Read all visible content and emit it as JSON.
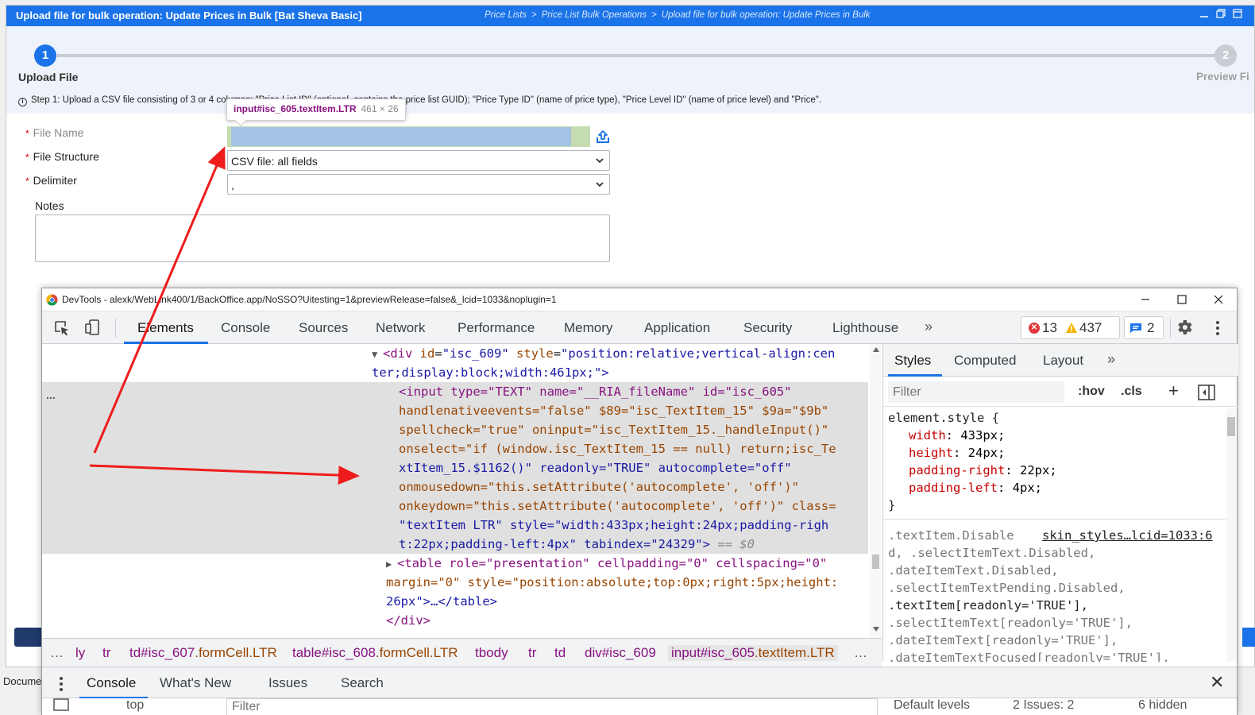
{
  "app": {
    "title": "Upload file for bulk operation: Update Prices in Bulk [Bat Sheva Basic]",
    "breadcrumb": [
      "Price Lists",
      "Price List Bulk Operations",
      "Upload file for bulk operation: Update Prices in Bulk"
    ],
    "breadcrumb_sep": ">",
    "window_buttons": [
      "minimize-icon",
      "restore-icon",
      "close-icon"
    ],
    "accent_color": "#1a73e8"
  },
  "wizard": {
    "steps": [
      {
        "number": "1",
        "label": "Upload File",
        "active": true
      },
      {
        "number": "2",
        "label": "Preview Fi",
        "active": false
      }
    ],
    "info_text": "Step 1: Upload a CSV file consisting of 3 or 4 columns: \"Price List ID\" (optional, contains the price list GUID); \"Price Type ID\" (name of price type), \"Price Level ID\" (name of price level) and \"Price\"."
  },
  "form": {
    "required_mark": "*",
    "file_name_label": "File Name",
    "file_structure_label": "File Structure",
    "file_structure_value": "CSV file: all fields",
    "delimiter_label": "Delimiter",
    "delimiter_value": ",",
    "notes_label": "Notes",
    "notes_value": ""
  },
  "inspect_tooltip": {
    "tag": "input#isc_605.textItem.LTR",
    "size": "461 × 26"
  },
  "taskbar_label": "Docume",
  "devtools": {
    "title": "DevTools - alexk/WebLink400/1/BackOffice.app/NoSSO?Uitesting=1&previewRelease=false&_lcid=1033&noplugin=1",
    "tabs": [
      "Elements",
      "Console",
      "Sources",
      "Network",
      "Performance",
      "Memory",
      "Application",
      "Security",
      "Lighthouse"
    ],
    "more_tabs": "»",
    "error_count": "13",
    "warning_count": "437",
    "issues_count": "2",
    "elements_code": {
      "line1_tag": "<div",
      "line1_attrs": [
        {
          "name": "id",
          "value": "\"isc_609\""
        },
        {
          "name": "style",
          "value": "\"position:relative;vertical-align:cen"
        }
      ],
      "line2": "ter;display:block;width:461px;\">",
      "input_lines": [
        "<input type=\"TEXT\" name=\"__RIA_fileName\" id=\"isc_605\"",
        "handlenativeevents=\"false\" $89=\"isc_TextItem_15\" $9a=\"$9b\"",
        "spellcheck=\"true\" oninput=\"isc_TextItem_15._handleInput()\"",
        "onselect=\"if (window.isc_TextItem_15 == null) return;isc_Te",
        "xtItem_15.$1162()\" readonly=\"TRUE\" autocomplete=\"off\"",
        "onmousedown=\"this.setAttribute('autocomplete', 'off')\"",
        "onkeydown=\"this.setAttribute('autocomplete', 'off')\" class=",
        "\"textItem LTR\" style=\"width:433px;height:24px;padding-righ",
        "t:22px;padding-left:4px\" tabindex=\"24329\">"
      ],
      "selected_marker": "== $0",
      "table_lines": [
        "<table role=\"presentation\" cellpadding=\"0\" cellspacing=\"0\"",
        "margin=\"0\" style=\"position:absolute;top:0px;right:5px;height:",
        "26px\">…</table>"
      ],
      "close_div": "</div>",
      "ellipsis": "..."
    },
    "styles_tabs": [
      "Styles",
      "Computed",
      "Layout"
    ],
    "styles_more": "»",
    "filter_placeholder": "Filter",
    "hov": ":hov",
    "cls": ".cls",
    "plus": "+",
    "element_style": {
      "selector": "element.style {",
      "props": [
        {
          "name": "width",
          "value": "433px;"
        },
        {
          "name": "height",
          "value": "24px;"
        },
        {
          "name": "padding-right",
          "value": "22px;"
        },
        {
          "name": "padding-left",
          "value": "4px;"
        }
      ],
      "close": "}"
    },
    "rule2": {
      "source_link": "skin_styles…lcid=1033:6",
      "selectors": [
        ".textItem.Disable",
        "d, .selectItemText.Disabled,",
        ".dateItemText.Disabled,",
        ".selectItemTextPending.Disabled,",
        ".textItem[readonly='TRUE'],",
        ".selectItemText[readonly='TRUE'],",
        ".dateItemText[readonly='TRUE'],",
        ".dateItemTextFocused[readonly='TRUE'],"
      ]
    },
    "crumbs": [
      {
        "tag": "ly",
        "cls": ""
      },
      {
        "tag": "tr",
        "cls": ""
      },
      {
        "tag": "td#isc_607",
        "cls": ".formCell.LTR"
      },
      {
        "tag": "table#isc_608",
        "cls": ".formCell.LTR"
      },
      {
        "tag": "tbody",
        "cls": ""
      },
      {
        "tag": "tr",
        "cls": ""
      },
      {
        "tag": "td",
        "cls": ""
      },
      {
        "tag": "div#isc_609",
        "cls": ""
      },
      {
        "tag": "input#isc_605",
        "cls": ".textItem.LTR"
      }
    ],
    "crumbs_more": "…",
    "drawer_tabs": [
      "Console",
      "What's New",
      "Issues",
      "Search"
    ],
    "drawer_close": "✕",
    "console_toolbar": {
      "context": "top",
      "filter_placeholder": "Filter",
      "levels": "Default levels",
      "issues": "2 Issues:",
      "issues_count": "2",
      "hidden": "6 hidden"
    }
  }
}
